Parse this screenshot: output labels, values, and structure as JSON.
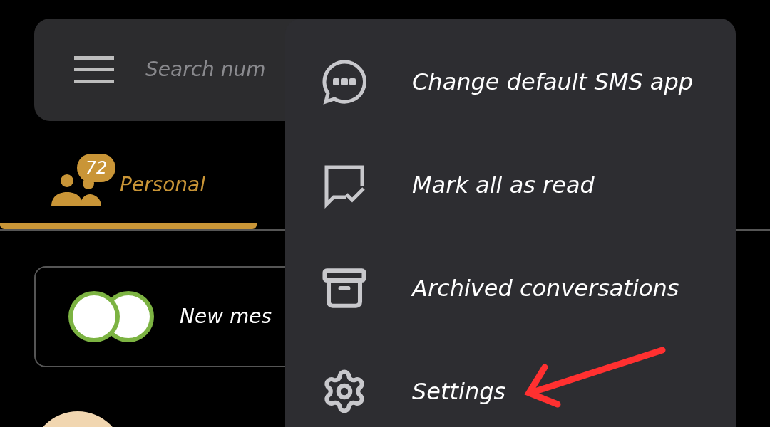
{
  "search": {
    "placeholder": "Search num"
  },
  "tabs": [
    {
      "label": "Personal",
      "badge": "72",
      "selected": true
    }
  ],
  "conversations": [
    {
      "preview": "New mes"
    }
  ],
  "menu": {
    "items": [
      {
        "kind": "sms",
        "label": "Change default SMS app"
      },
      {
        "kind": "mark-read",
        "label": "Mark all as read"
      },
      {
        "kind": "archive",
        "label": "Archived conversations"
      },
      {
        "kind": "settings",
        "label": "Settings"
      }
    ]
  }
}
